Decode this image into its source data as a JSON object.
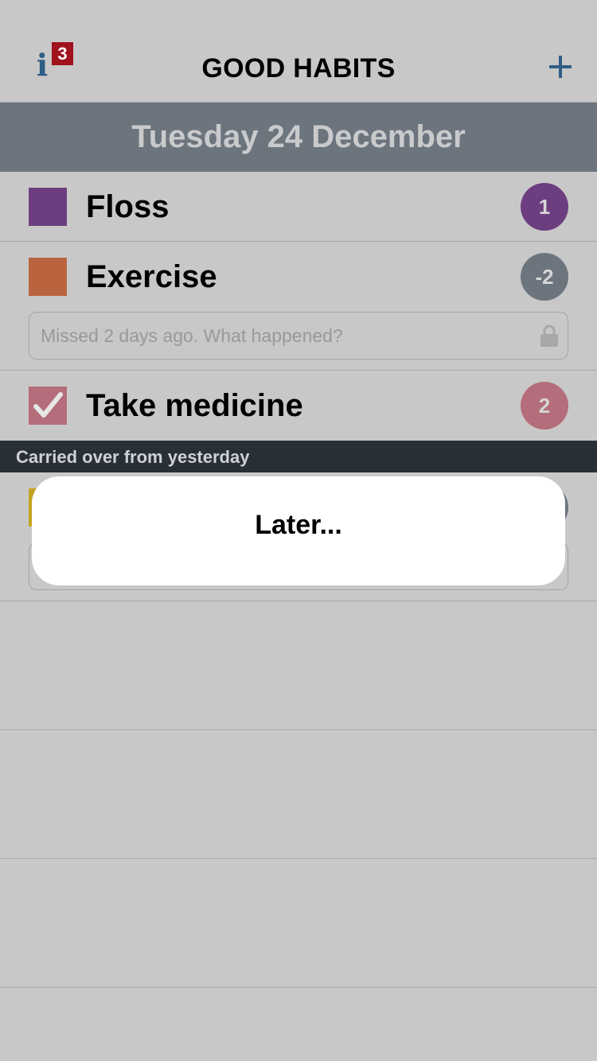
{
  "nav": {
    "title": "GOOD HABITS",
    "info_glyph": "i",
    "info_badge": "3",
    "info_icon": "info-icon",
    "add_icon": "plus-icon",
    "accent": "#2f5d86",
    "badge_color": "#a1121d"
  },
  "date_header": "Tuesday 24 December",
  "habits": [
    {
      "name": "Floss",
      "color": "#6c3e80",
      "streak": "1",
      "streak_color": "#6c3e80",
      "checked": false
    },
    {
      "name": "Exercise",
      "color": "#b9643e",
      "streak": "-2",
      "streak_color": "#6c747d",
      "checked": false,
      "note_placeholder": "Missed 2 days ago. What happened?",
      "note_icon": "lock-icon"
    },
    {
      "name": "Take medicine",
      "color": "#b46d7a",
      "streak": "2",
      "streak_color": "#b46d7a",
      "checked": true,
      "check_icon": "checkmark-icon"
    }
  ],
  "section": {
    "title": "Carried over from yesterday",
    "item_color": "#c4a322"
  },
  "popup": {
    "label": "Later..."
  }
}
